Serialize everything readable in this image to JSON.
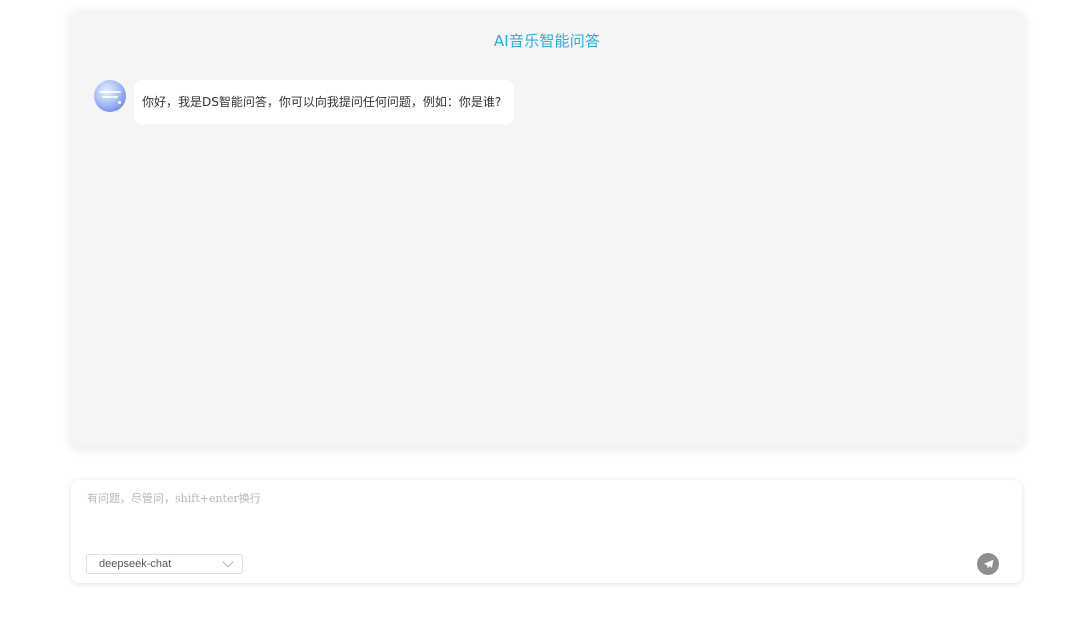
{
  "header": {
    "title": "AI音乐智能问答"
  },
  "messages": [
    {
      "role": "assistant",
      "avatar_icon": "music-ai-avatar",
      "text": "你好，我是DS智能问答，你可以向我提问任何问题，例如：你是谁?"
    }
  ],
  "composer": {
    "placeholder": "有问题，尽管问，shift+enter换行",
    "value": "",
    "model": {
      "selected": "deepseek-chat",
      "icon": "chevron-down-icon"
    },
    "send_icon": "paper-plane-icon"
  },
  "colors": {
    "accent": "#1eb0e8",
    "panel_bg": "#f5f5f6",
    "send_button": "#8e8e8e"
  }
}
